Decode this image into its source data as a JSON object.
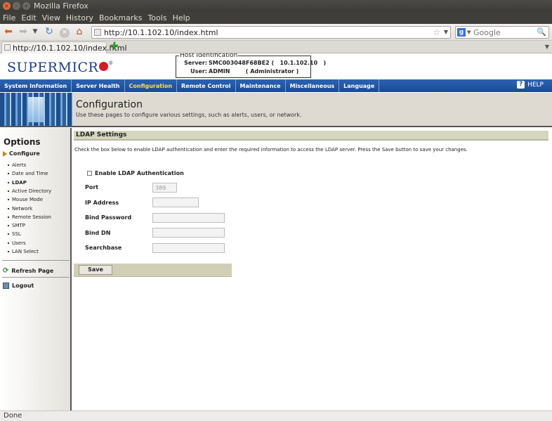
{
  "window": {
    "title": "Mozilla Firefox"
  },
  "menu": {
    "items": [
      "File",
      "Edit",
      "View",
      "History",
      "Bookmarks",
      "Tools",
      "Help"
    ]
  },
  "toolbar": {
    "url": "http://10.1.102.10/index.html",
    "search_placeholder": "Google"
  },
  "tabs": [
    {
      "label": "http://10.1.102.10/index.html"
    }
  ],
  "brand": {
    "logo_text": "SUPERMICR"
  },
  "host": {
    "legend": "Host Identification",
    "server_label": "Server:",
    "server_value": "SMC003048F68BE2 (   10.1.102.10   )",
    "user_label": "User:",
    "user_value": "ADMIN        ( Administrator )"
  },
  "nav": {
    "items": [
      "System Information",
      "Server Health",
      "Configuration",
      "Remote Control",
      "Maintenance",
      "Miscellaneous",
      "Language"
    ],
    "active_index": 2,
    "help": "HELP"
  },
  "banner": {
    "title": "Configuration",
    "subtitle": "Use these pages to configure various settings, such as alerts, users, or network."
  },
  "sidebar": {
    "title": "Options",
    "group": "Configure",
    "items": [
      "Alerts",
      "Date and Time",
      "LDAP",
      "Active Directory",
      "Mouse Mode",
      "Network",
      "Remote Session",
      "SMTP",
      "SSL",
      "Users",
      "LAN Select"
    ],
    "selected_index": 2,
    "refresh": "Refresh Page",
    "logout": "Logout"
  },
  "ldap": {
    "header": "LDAP Settings",
    "description": "Check the box below to enable LDAP authentication and enter the required information to access the LDAP server. Press the Save button to save your changes.",
    "enable_label": "Enable LDAP Authentication",
    "fields": [
      {
        "label": "Port",
        "value": "389"
      },
      {
        "label": "IP Address",
        "value": ""
      },
      {
        "label": "Bind Password",
        "value": ""
      },
      {
        "label": "Bind DN",
        "value": ""
      },
      {
        "label": "Searchbase",
        "value": ""
      }
    ],
    "save": "Save"
  },
  "status": {
    "text": "Done"
  }
}
